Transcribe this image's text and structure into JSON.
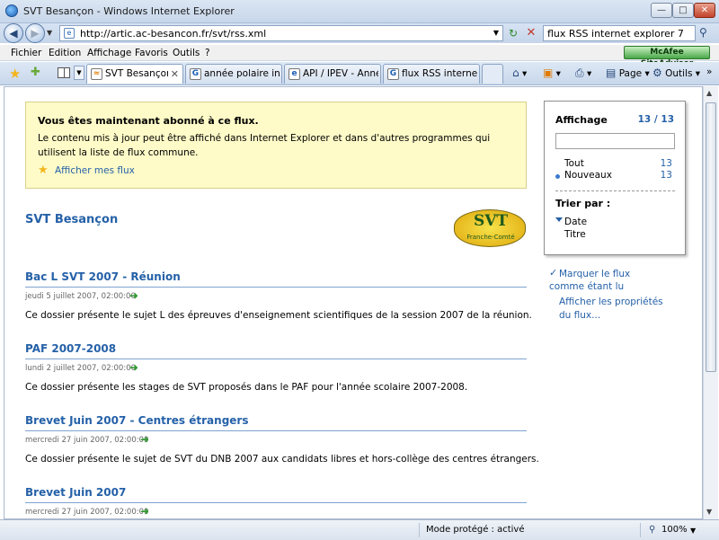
{
  "window": {
    "title": "SVT Besançon - Windows Internet Explorer"
  },
  "address": {
    "url": "http://artic.ac-besancon.fr/svt/rss.xml",
    "search_value": "flux RSS internet explorer 7"
  },
  "menu": [
    "Fichier",
    "Edition",
    "Affichage",
    "Favoris",
    "Outils",
    "?"
  ],
  "mcafee": "McAfee SiteAdvisor",
  "tabs": [
    {
      "label": "SVT Besançon",
      "icon": "rss-icon",
      "active": true
    },
    {
      "label": "année polaire inter...",
      "icon": "google-icon"
    },
    {
      "label": "API / IPEV - Année ...",
      "icon": "page-icon"
    },
    {
      "label": "flux RSS internet ex...",
      "icon": "google-icon"
    }
  ],
  "commands": {
    "page": "Page",
    "tools": "Outils"
  },
  "notice": {
    "title": "Vous êtes maintenant abonné à ce flux.",
    "text": "Le contenu mis à jour peut être affiché dans Internet Explorer et dans d'autres programmes qui utilisent la liste de flux commune.",
    "link": "Afficher mes flux"
  },
  "feed": {
    "title": "SVT Besançon",
    "logo_text": "SVT",
    "logo_sub": "Franche-Comté",
    "entries": [
      {
        "title": "Bac L SVT 2007 - Réunion",
        "date": "jeudi 5 juillet 2007, 02:00:00",
        "desc": "Ce dossier présente le sujet L des épreuves d'enseignement scientifiques de la session 2007 de la réunion."
      },
      {
        "title": "PAF 2007-2008",
        "date": "lundi 2 juillet 2007, 02:00:00",
        "desc": "Ce dossier présente les stages de SVT proposés dans le PAF pour l'année scolaire 2007-2008."
      },
      {
        "title": "Brevet Juin 2007 - Centres étrangers",
        "date": "mercredi 27 juin 2007, 02:00:00",
        "desc": "Ce dossier présente le sujet de SVT du DNB 2007 aux candidats libres et hors-collège des centres étrangers."
      },
      {
        "title": "Brevet Juin 2007",
        "date": "mercredi 27 juin 2007, 02:00:00",
        "desc": ""
      }
    ]
  },
  "filter": {
    "heading": "Affichage",
    "count": "13 / 13",
    "all_label": "Tout",
    "all_count": "13",
    "new_label": "Nouveaux",
    "new_count": "13",
    "sort_heading": "Trier par :",
    "sort_date": "Date",
    "sort_title": "Titre"
  },
  "side_links": {
    "mark_read": [
      "Marquer le flux",
      "comme étant lu"
    ],
    "properties": [
      "Afficher les propriétés",
      "du flux..."
    ]
  },
  "status": {
    "protected_mode": "Mode protégé : activé",
    "zoom": "100%"
  }
}
